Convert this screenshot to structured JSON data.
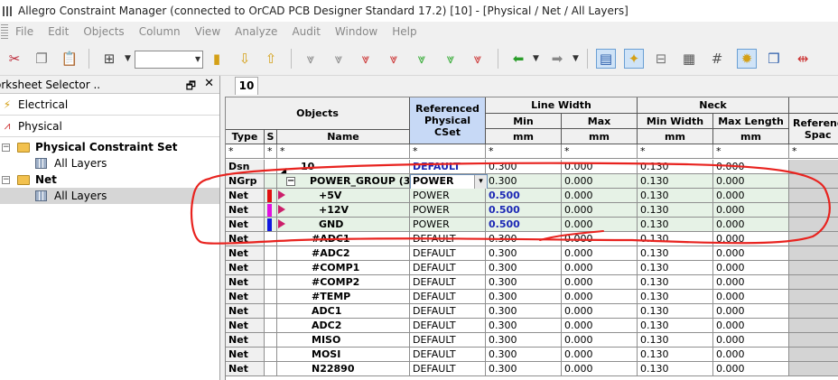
{
  "window": {
    "title": "Allegro Constraint Manager (connected to OrCAD PCB Designer Standard 17.2) [10] - [Physical / Net / All Layers]"
  },
  "menu": [
    "File",
    "Edit",
    "Objects",
    "Column",
    "View",
    "Analyze",
    "Audit",
    "Window",
    "Help"
  ],
  "worksheet_selector": {
    "title": "orksheet Selector ..",
    "sections": [
      {
        "label": "Electrical",
        "icon": "lightning-icon"
      },
      {
        "label": "Physical",
        "icon": "trace-icon"
      }
    ],
    "tree": [
      {
        "label": "Physical Constraint Set",
        "level": 0,
        "bold": true,
        "icon": "folder-icon"
      },
      {
        "label": "All Layers",
        "level": 1,
        "bold": false,
        "icon": "grid-icon"
      },
      {
        "label": "Net",
        "level": 0,
        "bold": true,
        "icon": "folder-icon"
      },
      {
        "label": "All Layers",
        "level": 1,
        "bold": false,
        "icon": "grid-icon",
        "selected": true
      }
    ]
  },
  "tab": {
    "label": "10"
  },
  "grid": {
    "headers": {
      "objects": "Objects",
      "referenced": "Referenced Physical CSet",
      "line_width": "Line Width",
      "neck": "Neck",
      "referenced_spacing": "Referenc Spac",
      "type": "Type",
      "s": "S",
      "name": "Name",
      "min": "Min",
      "max": "Max",
      "min_width": "Min Width",
      "max_length": "Max Length",
      "unit": "mm",
      "filter": "*"
    },
    "rows": [
      {
        "type": "Dsn",
        "name": "10",
        "ref": "DEFAULT",
        "ref_blue": true,
        "lw_min": "0.300",
        "lw_max": "0.000",
        "neck_min": "0.130",
        "neck_max": "0.000"
      },
      {
        "type": "NGrp",
        "name": "POWER_GROUP (3)",
        "ref": "POWER",
        "lw_min": "0.300",
        "lw_max": "0.000",
        "neck_min": "0.130",
        "neck_max": "0.000"
      },
      {
        "type": "Net",
        "name": "+5V",
        "ref": "POWER",
        "lw_min": "0.500",
        "lw_max": "0.000",
        "neck_min": "0.130",
        "neck_max": "0.000",
        "color": "#e01010"
      },
      {
        "type": "Net",
        "name": "+12V",
        "ref": "POWER",
        "lw_min": "0.500",
        "lw_max": "0.000",
        "neck_min": "0.130",
        "neck_max": "0.000",
        "color": "#e010e0"
      },
      {
        "type": "Net",
        "name": "GND",
        "ref": "POWER",
        "lw_min": "0.500",
        "lw_max": "0.000",
        "neck_min": "0.130",
        "neck_max": "0.000",
        "color": "#1018e0"
      },
      {
        "type": "Net",
        "name": "#ADC1",
        "ref": "DEFAULT",
        "lw_min": "0.300",
        "lw_max": "0.000",
        "neck_min": "0.130",
        "neck_max": "0.000"
      },
      {
        "type": "Net",
        "name": "#ADC2",
        "ref": "DEFAULT",
        "lw_min": "0.300",
        "lw_max": "0.000",
        "neck_min": "0.130",
        "neck_max": "0.000"
      },
      {
        "type": "Net",
        "name": "#COMP1",
        "ref": "DEFAULT",
        "lw_min": "0.300",
        "lw_max": "0.000",
        "neck_min": "0.130",
        "neck_max": "0.000"
      },
      {
        "type": "Net",
        "name": "#COMP2",
        "ref": "DEFAULT",
        "lw_min": "0.300",
        "lw_max": "0.000",
        "neck_min": "0.130",
        "neck_max": "0.000"
      },
      {
        "type": "Net",
        "name": "#TEMP",
        "ref": "DEFAULT",
        "lw_min": "0.300",
        "lw_max": "0.000",
        "neck_min": "0.130",
        "neck_max": "0.000"
      },
      {
        "type": "Net",
        "name": "ADC1",
        "ref": "DEFAULT",
        "lw_min": "0.300",
        "lw_max": "0.000",
        "neck_min": "0.130",
        "neck_max": "0.000"
      },
      {
        "type": "Net",
        "name": "ADC2",
        "ref": "DEFAULT",
        "lw_min": "0.300",
        "lw_max": "0.000",
        "neck_min": "0.130",
        "neck_max": "0.000"
      },
      {
        "type": "Net",
        "name": "MISO",
        "ref": "DEFAULT",
        "lw_min": "0.300",
        "lw_max": "0.000",
        "neck_min": "0.130",
        "neck_max": "0.000"
      },
      {
        "type": "Net",
        "name": "MOSI",
        "ref": "DEFAULT",
        "lw_min": "0.300",
        "lw_max": "0.000",
        "neck_min": "0.130",
        "neck_max": "0.000"
      },
      {
        "type": "Net",
        "name": "N22890",
        "ref": "DEFAULT",
        "lw_min": "0.300",
        "lw_max": "0.000",
        "neck_min": "0.130",
        "neck_max": "0.000"
      }
    ]
  },
  "colors": {
    "annotation": "#e8231f",
    "referenced_header": "#c7d9f6",
    "group_row": "#e6f2e6",
    "value_blue": "#1c28b5"
  }
}
